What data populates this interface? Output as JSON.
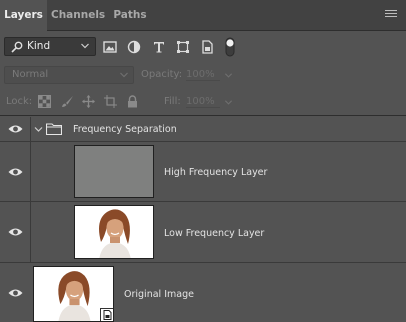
{
  "tabs": [
    {
      "label": "Layers",
      "active": true
    },
    {
      "label": "Channels",
      "active": false
    },
    {
      "label": "Paths",
      "active": false
    }
  ],
  "filter": {
    "kind_label": "Kind",
    "icons": [
      "pixel-layer-filter-icon",
      "adjustment-layer-filter-icon",
      "type-layer-filter-icon",
      "shape-layer-filter-icon",
      "smart-object-filter-icon",
      "filter-toggle-icon"
    ]
  },
  "blend": {
    "mode": "Normal",
    "opacity_label": "Opacity:",
    "opacity_value": "100%",
    "fill_label": "Fill:",
    "fill_value": "100%"
  },
  "lock": {
    "label": "Lock:",
    "icons": [
      "lock-transparent-pixels-icon",
      "lock-image-pixels-icon",
      "lock-position-icon",
      "lock-artboard-icon",
      "lock-all-icon"
    ]
  },
  "layers": {
    "group": {
      "name": "Frequency Separation",
      "expanded": true,
      "visible": true
    },
    "items": [
      {
        "name": "High Frequency Layer",
        "thumb": "gray",
        "visible": true
      },
      {
        "name": "Low Frequency Layer",
        "thumb": "portrait",
        "visible": true
      },
      {
        "name": "Original Image",
        "thumb": "portrait",
        "visible": true,
        "smart_object": true
      }
    ]
  },
  "colors": {
    "panel_bg": "#535353",
    "tab_bar_bg": "#424242",
    "text": "#e3e3e3"
  }
}
